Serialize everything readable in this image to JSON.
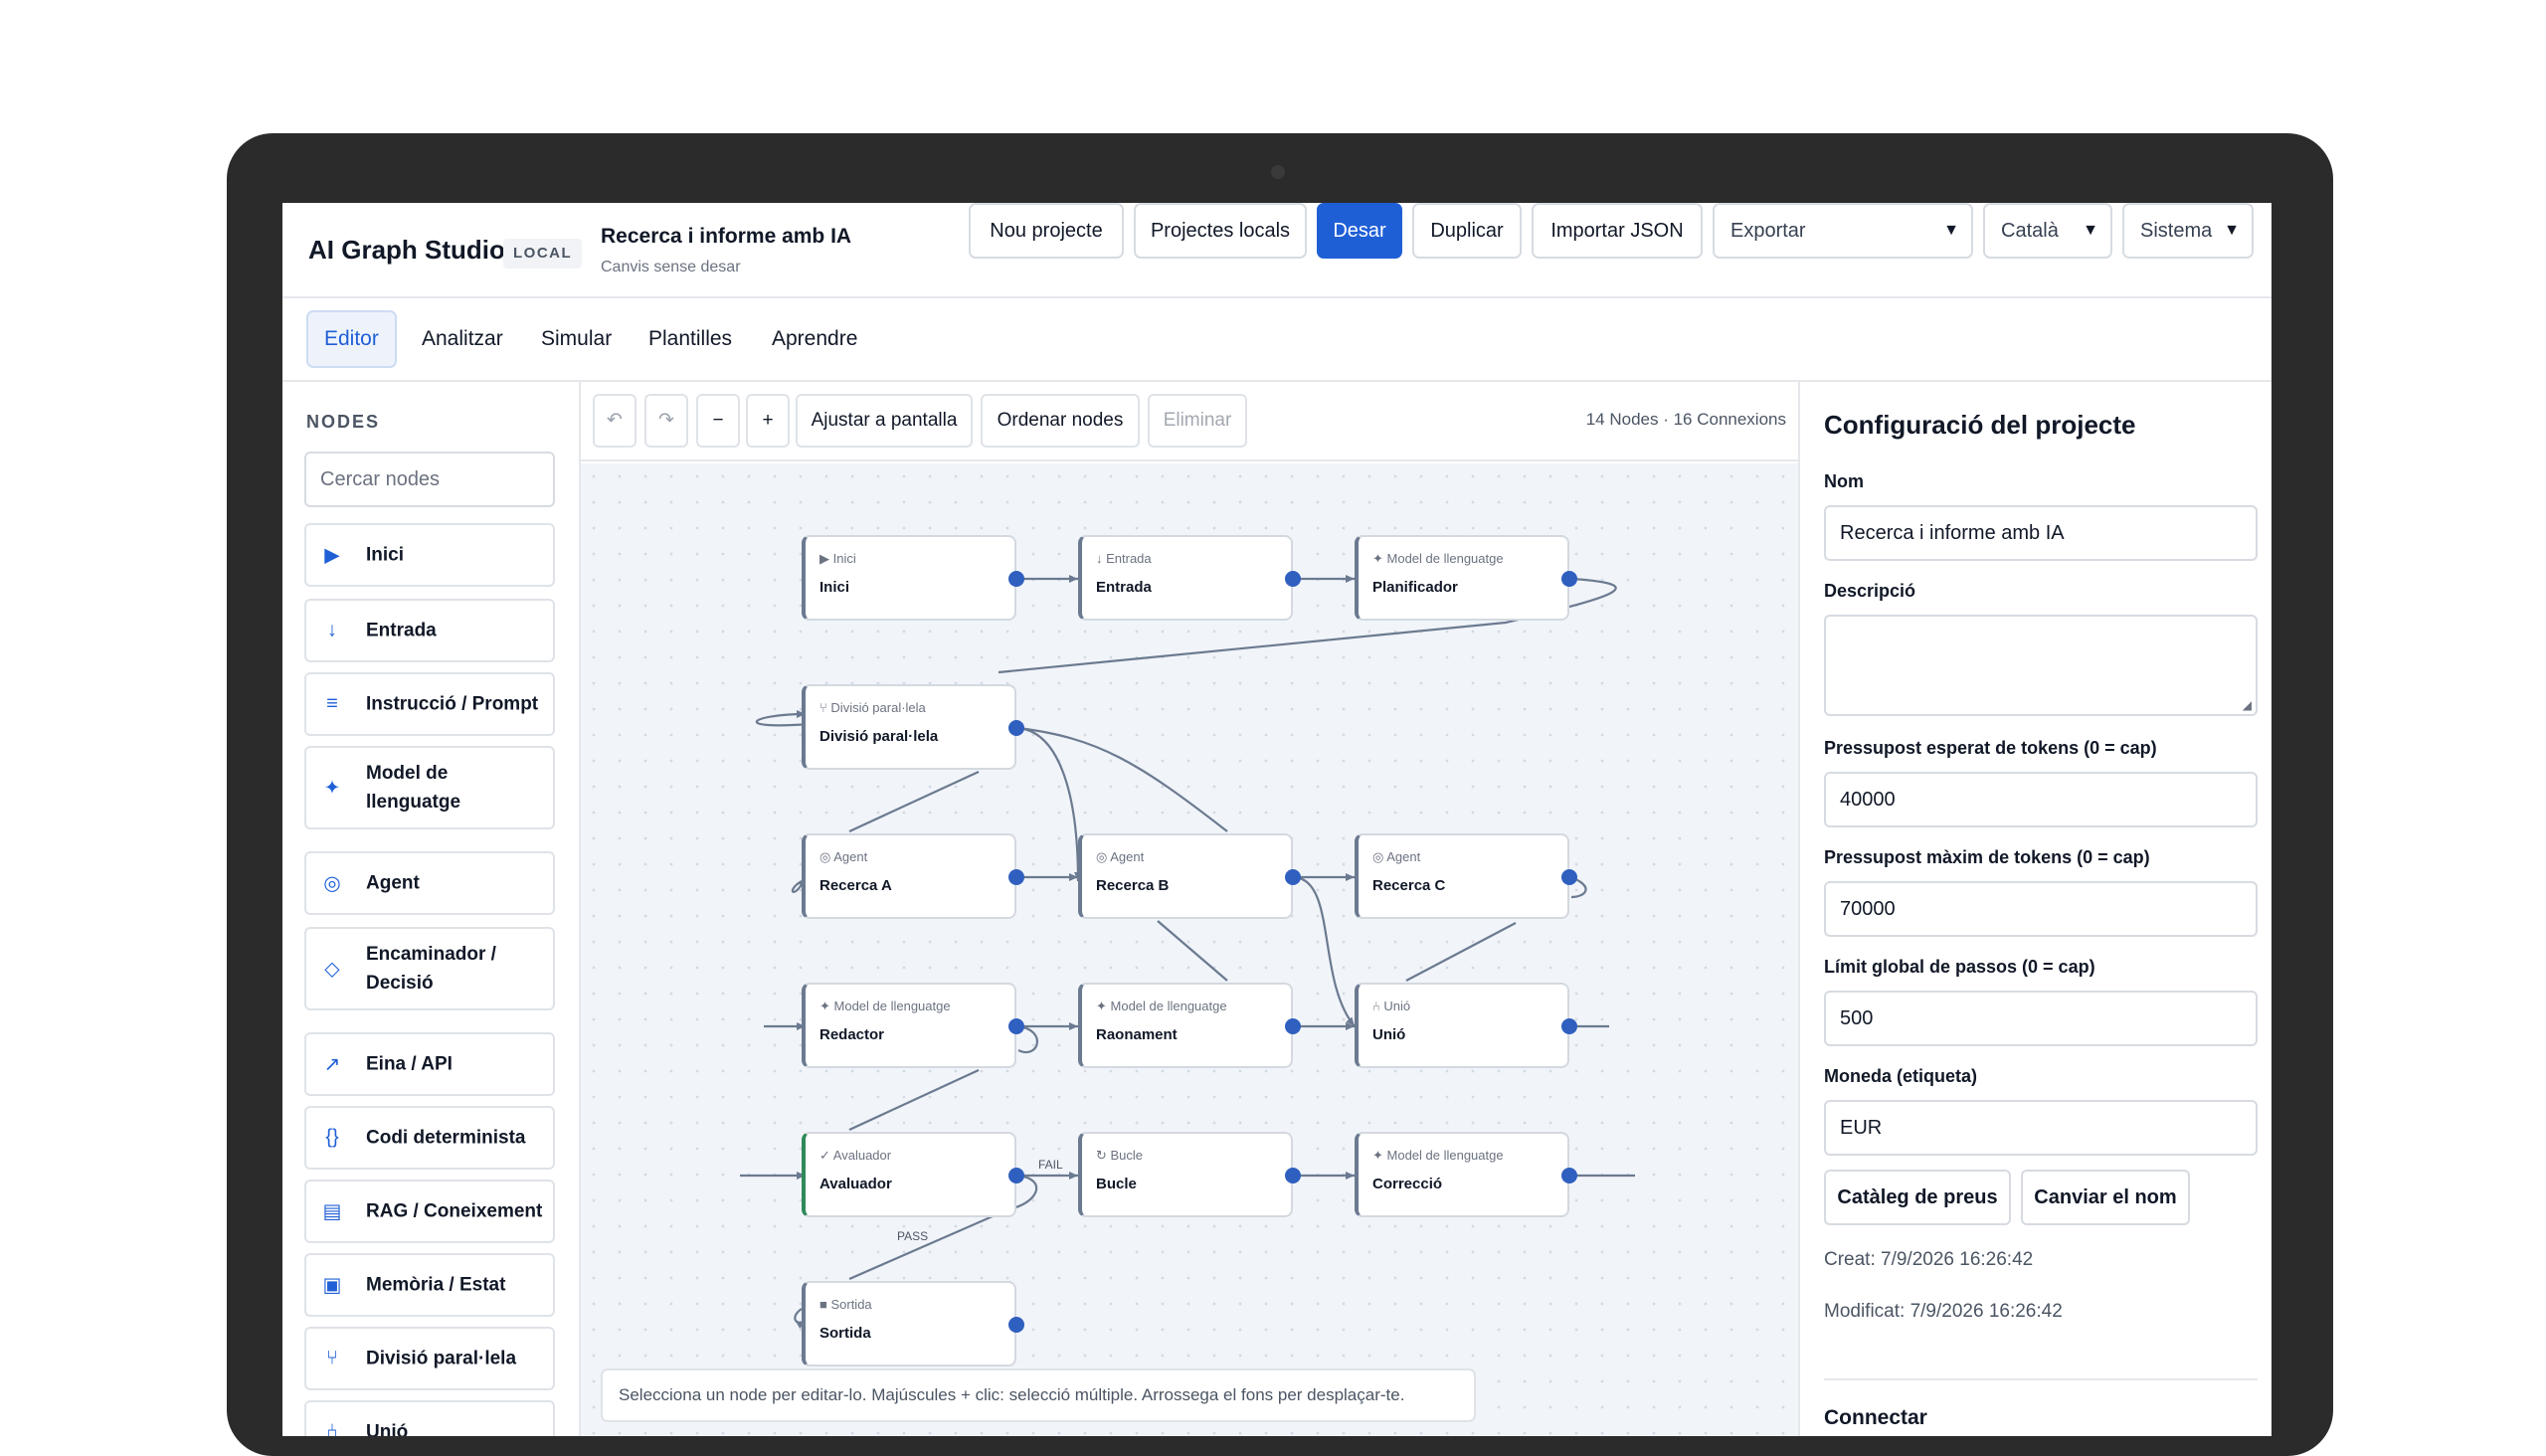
{
  "app": {
    "brand": "AI Graph Studio",
    "badge": "LOCAL",
    "project_title": "Recerca i informe amb IA",
    "project_status": "Canvis sense desar"
  },
  "header_buttons": {
    "new_project": "Nou projecte",
    "local_projects": "Projectes locals",
    "save": "Desar",
    "duplicate": "Duplicar",
    "import_json": "Importar JSON"
  },
  "selects": {
    "export": "Exportar",
    "language": "Català",
    "theme": "Sistema"
  },
  "tabs": [
    {
      "label": "Editor"
    },
    {
      "label": "Analitzar"
    },
    {
      "label": "Simular"
    },
    {
      "label": "Plantilles"
    },
    {
      "label": "Aprendre"
    }
  ],
  "sidebar": {
    "heading": "NODES",
    "search_placeholder": "Cercar nodes",
    "items": [
      {
        "label": "Inici",
        "icon": "play-icon",
        "glyph": "▶"
      },
      {
        "label": "Entrada",
        "icon": "arrow-down-icon",
        "glyph": "↓"
      },
      {
        "label": "Instrucció / Prompt",
        "icon": "lines-icon",
        "glyph": "≡"
      },
      {
        "label": "Model de llenguatge",
        "icon": "sparkle-icon",
        "glyph": "✦"
      },
      {
        "label": "Agent",
        "icon": "target-icon",
        "glyph": "◎"
      },
      {
        "label": "Encaminador / Decisió",
        "icon": "diamond-icon",
        "glyph": "◇"
      },
      {
        "label": "Eina / API",
        "icon": "arrow-up-right-icon",
        "glyph": "↗"
      },
      {
        "label": "Codi determinista",
        "icon": "braces-icon",
        "glyph": "{}"
      },
      {
        "label": "RAG / Coneixement",
        "icon": "database-icon",
        "glyph": "▤"
      },
      {
        "label": "Memòria / Estat",
        "icon": "memory-icon",
        "glyph": "▣"
      },
      {
        "label": "Divisió paral·lela",
        "icon": "fork-icon",
        "glyph": "⑂"
      },
      {
        "label": "Unió",
        "icon": "merge-icon",
        "glyph": "⑃"
      }
    ]
  },
  "toolbar": {
    "undo": "↶",
    "redo": "↷",
    "zoom_out": "−",
    "zoom_in": "+",
    "fit": "Ajustar a pantalla",
    "arrange": "Ordenar nodes",
    "delete": "Eliminar",
    "counts": "14 Nodes · 16 Connexions"
  },
  "graph": {
    "nodes": [
      {
        "id": "n1",
        "type": "▶ Inici",
        "title": "Inici"
      },
      {
        "id": "n2",
        "type": "↓ Entrada",
        "title": "Entrada"
      },
      {
        "id": "n3",
        "type": "✦ Model de llenguatge",
        "title": "Planificador"
      },
      {
        "id": "n4",
        "type": "⑂ Divisió paral·lela",
        "title": "Divisió paral·lela"
      },
      {
        "id": "n5",
        "type": "◎ Agent",
        "title": "Recerca A"
      },
      {
        "id": "n6",
        "type": "◎ Agent",
        "title": "Recerca B"
      },
      {
        "id": "n7",
        "type": "◎ Agent",
        "title": "Recerca C"
      },
      {
        "id": "n8",
        "type": "✦ Model de llenguatge",
        "title": "Redactor"
      },
      {
        "id": "n9",
        "type": "✦ Model de llenguatge",
        "title": "Raonament"
      },
      {
        "id": "n10",
        "type": "⑃ Unió",
        "title": "Unió"
      },
      {
        "id": "n11",
        "type": "✓ Avaluador",
        "title": "Avaluador"
      },
      {
        "id": "n12",
        "type": "↻ Bucle",
        "title": "Bucle"
      },
      {
        "id": "n13",
        "type": "✦ Model de llenguatge",
        "title": "Correcció"
      },
      {
        "id": "n14",
        "type": "■ Sortida",
        "title": "Sortida"
      }
    ],
    "edge_labels": {
      "fail": "FAIL",
      "pass": "PASS"
    },
    "hint": "Selecciona un node per editar-lo. Majúscules + clic: selecció múltiple. Arrossega el fons per desplaçar-te."
  },
  "config": {
    "title": "Configuració del projecte",
    "name_label": "Nom",
    "name_value": "Recerca i informe amb IA",
    "description_label": "Descripció",
    "description_value": "",
    "expected_tokens_label": "Pressupost esperat de tokens (0 = cap)",
    "expected_tokens_value": "40000",
    "max_tokens_label": "Pressupost màxim de tokens (0 = cap)",
    "max_tokens_value": "70000",
    "steps_label": "Límit global de passos (0 = cap)",
    "steps_value": "500",
    "currency_label": "Moneda (etiqueta)",
    "currency_value": "EUR",
    "price_catalog": "Catàleg de preus",
    "rename": "Canviar el nom",
    "created": "Creat: 7/9/2026 16:26:42",
    "modified": "Modificat: 7/9/2026 16:26:42",
    "connect": "Connectar"
  },
  "colors": {
    "accent": "#1f5fd6",
    "port": "#2f5fbf",
    "canvas_bg": "#f1f4f9",
    "evaluator_accent": "#2f8a5a"
  }
}
